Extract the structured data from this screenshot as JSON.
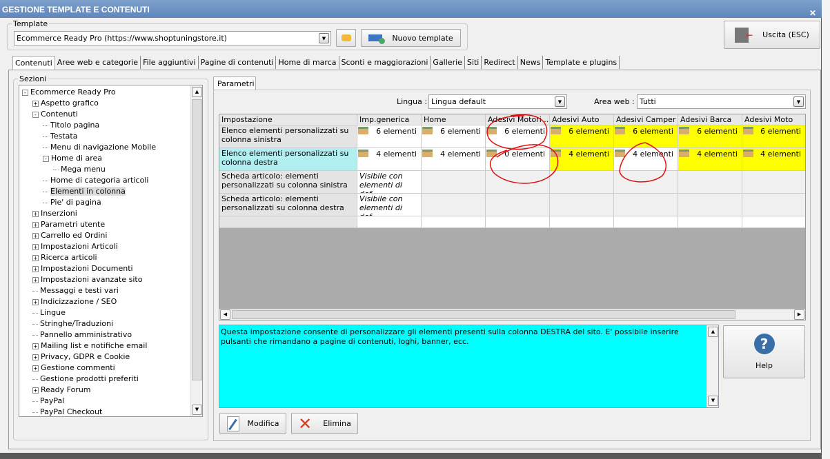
{
  "window": {
    "title": "GESTIONE TEMPLATE E CONTENUTI",
    "close_label": "✕"
  },
  "template": {
    "legend": "Template",
    "value": "Ecommerce Ready Pro (https://www.shoptuningstore.it)",
    "new_label": "Nuovo template"
  },
  "exit_label": "Uscita (ESC)",
  "tabs": [
    "Contenuti",
    "Aree web e categorie",
    "File aggiuntivi",
    "Pagine di contenuti",
    "Home di marca",
    "Sconti e maggiorazioni",
    "Gallerie",
    "Siti",
    "Redirect",
    "News",
    "Template e plugins"
  ],
  "sections": {
    "legend": "Sezioni",
    "items": [
      {
        "label": "Ecommerce Ready Pro",
        "depth": 0,
        "exp": "-"
      },
      {
        "label": "Aspetto grafico",
        "depth": 1,
        "exp": "+"
      },
      {
        "label": "Contenuti",
        "depth": 1,
        "exp": "-"
      },
      {
        "label": "Titolo pagina",
        "depth": 2,
        "exp": ""
      },
      {
        "label": "Testata",
        "depth": 2,
        "exp": ""
      },
      {
        "label": "Menu di navigazione Mobile",
        "depth": 2,
        "exp": ""
      },
      {
        "label": "Home di area",
        "depth": 2,
        "exp": "-"
      },
      {
        "label": "Mega menu",
        "depth": 3,
        "exp": ""
      },
      {
        "label": "Home di categoria articoli",
        "depth": 2,
        "exp": ""
      },
      {
        "label": "Elementi in colonna",
        "depth": 2,
        "exp": "",
        "selected": true
      },
      {
        "label": "Pie' di pagina",
        "depth": 2,
        "exp": ""
      },
      {
        "label": "Inserzioni",
        "depth": 1,
        "exp": "+"
      },
      {
        "label": "Parametri utente",
        "depth": 1,
        "exp": "+"
      },
      {
        "label": "Carrello ed Ordini",
        "depth": 1,
        "exp": "+"
      },
      {
        "label": "Impostazioni Articoli",
        "depth": 1,
        "exp": "+"
      },
      {
        "label": "Ricerca articoli",
        "depth": 1,
        "exp": "+"
      },
      {
        "label": "Impostazioni Documenti",
        "depth": 1,
        "exp": "+"
      },
      {
        "label": "Impostazioni avanzate sito",
        "depth": 1,
        "exp": "+"
      },
      {
        "label": "Messaggi e testi vari",
        "depth": 1,
        "exp": ""
      },
      {
        "label": "Indicizzazione / SEO",
        "depth": 1,
        "exp": "+"
      },
      {
        "label": "Lingue",
        "depth": 1,
        "exp": ""
      },
      {
        "label": "Stringhe/Traduzioni",
        "depth": 1,
        "exp": ""
      },
      {
        "label": "Pannello amministrativo",
        "depth": 1,
        "exp": ""
      },
      {
        "label": "Mailing list e notifiche email",
        "depth": 1,
        "exp": "+"
      },
      {
        "label": "Privacy, GDPR e Cookie",
        "depth": 1,
        "exp": "+"
      },
      {
        "label": "Gestione commenti",
        "depth": 1,
        "exp": "+"
      },
      {
        "label": "Gestione prodotti preferiti",
        "depth": 1,
        "exp": ""
      },
      {
        "label": "Ready Forum",
        "depth": 1,
        "exp": "+"
      },
      {
        "label": "PayPal",
        "depth": 1,
        "exp": ""
      },
      {
        "label": "PayPal Checkout",
        "depth": 1,
        "exp": ""
      }
    ]
  },
  "params": {
    "tab": "Parametri",
    "lingua_label": "Lingua :",
    "lingua_value": "Lingua default",
    "area_label": "Area web :",
    "area_value": "Tutti"
  },
  "grid": {
    "columns": [
      "Impostazione",
      "Imp.generica",
      "Home",
      "Adesivi Motori ...",
      "Adesivi Auto",
      "Adesivi Camper",
      "Adesivi Barca",
      "Adesivi Moto"
    ],
    "rows": [
      {
        "label": "Elenco elementi personalizzati su colonna sinistra",
        "cells": [
          {
            "text": "6 elementi",
            "folder": true
          },
          {
            "text": "6 elementi",
            "folder": true
          },
          {
            "text": "6 elementi",
            "folder": true
          },
          {
            "text": "6 elementi",
            "folder": true,
            "hl": true
          },
          {
            "text": "6 elementi",
            "folder": true,
            "hl": true
          },
          {
            "text": "6 elementi",
            "folder": true,
            "hl": true
          },
          {
            "text": "6 elementi",
            "folder": true,
            "hl": true
          }
        ]
      },
      {
        "label": "Elenco elementi personalizzati su colonna destra",
        "selected": true,
        "cells": [
          {
            "text": "4 elementi",
            "folder": true
          },
          {
            "text": "4 elementi",
            "folder": true
          },
          {
            "text": "0 elementi",
            "folder": true
          },
          {
            "text": "4 elementi",
            "folder": true,
            "hl": true
          },
          {
            "text": "4 elementi",
            "folder": true
          },
          {
            "text": "4 elementi",
            "folder": true,
            "hl": true
          },
          {
            "text": "4 elementi",
            "folder": true,
            "hl": true
          }
        ]
      },
      {
        "label": "Scheda articolo: elementi personalizzati su colonna sinistra",
        "cells": [
          {
            "text": "Visibile con elementi di def...",
            "italic": true
          },
          {
            "text": ""
          },
          {
            "text": ""
          },
          {
            "text": ""
          },
          {
            "text": ""
          },
          {
            "text": ""
          },
          {
            "text": ""
          }
        ]
      },
      {
        "label": "Scheda articolo: elementi personalizzati su colonna destra",
        "cells": [
          {
            "text": "Visibile con elementi di def...",
            "italic": true
          },
          {
            "text": ""
          },
          {
            "text": ""
          },
          {
            "text": ""
          },
          {
            "text": ""
          },
          {
            "text": ""
          },
          {
            "text": ""
          }
        ]
      }
    ]
  },
  "description": "Questa impostazione consente di personalizzare gli elementi presenti sulla colonna DESTRA del sito. E' possibile inserire pulsanti che rimandano a pagine di contenuti, loghi, banner, ecc.",
  "help_label": "Help",
  "modifica_label": "Modifica",
  "elimina_label": "Elimina",
  "colors": {
    "highlight": "#ffff00",
    "description_bg": "#00ffff",
    "selected_row": "#b0eef0",
    "annotation": "#e01010"
  }
}
